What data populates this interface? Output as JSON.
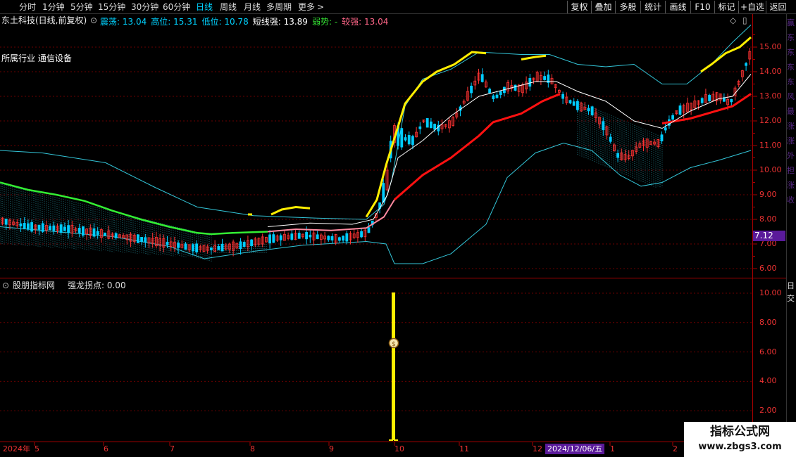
{
  "toolbar": {
    "periods": [
      "分时",
      "1分钟",
      "5分钟",
      "15分钟",
      "30分钟",
      "60分钟",
      "日线",
      "周线",
      "月线",
      "多周期",
      "更多"
    ],
    "active_period": "日线",
    "more_arrow": ">",
    "right_buttons": [
      "复权",
      "叠加",
      "多股",
      "统计",
      "画线",
      "F10",
      "标记",
      "+自选",
      "返回"
    ]
  },
  "main_chart": {
    "stock_title": "东土科技(日线,前复权)",
    "legend": [
      {
        "label": "震荡",
        "value": "13.04",
        "color": "#00d2ff"
      },
      {
        "label": "高位",
        "value": "15.31",
        "color": "#00d2ff"
      },
      {
        "label": "低位",
        "value": "10.78",
        "color": "#00d2ff"
      },
      {
        "label": "短线强",
        "value": "13.89",
        "color": "#ffffff"
      },
      {
        "label": "弱势",
        "value": "-",
        "color": "#33dd33"
      },
      {
        "label": "较强",
        "value": "13.04",
        "color": "#ff6688"
      }
    ],
    "industry_note": "所属行业 通信设备",
    "price_scale": [
      "15.00",
      "14.00",
      "13.00",
      "12.00",
      "11.00",
      "10.00",
      "9.00",
      "8.00",
      "7.00",
      "6.00"
    ],
    "current_price_tag": "7.12",
    "side_strip_text": "赢 东 东 东 东 风 最 涨 涨 外 担 涨 收"
  },
  "indicator_panel": {
    "title": "股朋指标网",
    "indicator_name": "强龙拐点",
    "value": "0.00",
    "scale": [
      "10.00",
      "8.00",
      "6.00",
      "4.00",
      "2.00"
    ],
    "signal_icon": "moneybag-icon",
    "signal_icon_glyph": "$",
    "side_strip_text": "日 交"
  },
  "date_axis": {
    "labels": [
      "2024年",
      "5",
      "6",
      "7",
      "8",
      "9",
      "10",
      "11",
      "12",
      "1",
      "2"
    ],
    "cursor_date": "2024/12/06/五"
  },
  "watermark": {
    "line1": "指标公式网",
    "line2": "www.zbgs3.com"
  },
  "colors": {
    "background": "#000000",
    "grid": "#6a0000",
    "axis": "#aa0000",
    "up_candle": "#ff3333",
    "down_candle": "#00ccff",
    "band": "#33c5d8",
    "strong_line": "#ffee00",
    "weak_line": "#33ee33",
    "support_line": "#ff1111",
    "mid_line": "#ffffff",
    "signal_bar": "#ffee00",
    "price_tag_bg": "#5a1a9a"
  }
}
